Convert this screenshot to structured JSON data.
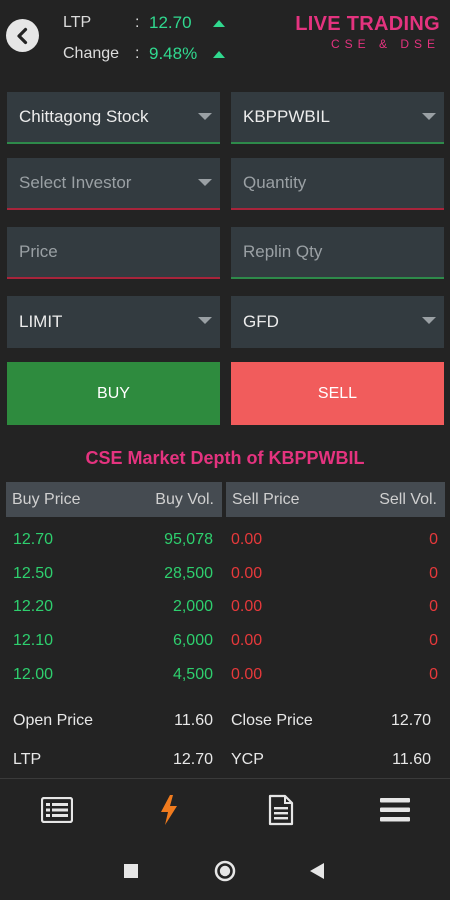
{
  "header": {
    "ltp_label": "LTP",
    "ltp_value": "12.70",
    "change_label": "Change",
    "change_value": "9.48%",
    "colon": ":",
    "brand_title": "LIVE TRADING",
    "brand_subtitle": "CSE & DSE"
  },
  "form": {
    "exchange": "Chittagong Stock",
    "symbol": "KBPPWBIL",
    "investor_placeholder": "Select Investor",
    "quantity_placeholder": "Quantity",
    "price_placeholder": "Price",
    "replin_placeholder": "Replin Qty",
    "order_type": "LIMIT",
    "validity": "GFD",
    "buy_label": "BUY",
    "sell_label": "SELL"
  },
  "depth": {
    "title": "CSE Market Depth of KBPPWBIL",
    "columns": {
      "buy_price": "Buy Price",
      "buy_vol": "Buy Vol.",
      "sell_price": "Sell Price",
      "sell_vol": "Sell Vol."
    },
    "buy_rows": [
      {
        "price": "12.70",
        "vol": "95,078"
      },
      {
        "price": "12.50",
        "vol": "28,500"
      },
      {
        "price": "12.20",
        "vol": "2,000"
      },
      {
        "price": "12.10",
        "vol": "6,000"
      },
      {
        "price": "12.00",
        "vol": "4,500"
      }
    ],
    "sell_rows": [
      {
        "price": "0.00",
        "vol": "0"
      },
      {
        "price": "0.00",
        "vol": "0"
      },
      {
        "price": "0.00",
        "vol": "0"
      },
      {
        "price": "0.00",
        "vol": "0"
      },
      {
        "price": "0.00",
        "vol": "0"
      }
    ]
  },
  "info": {
    "open_label": "Open Price",
    "open_value": "11.60",
    "close_label": "Close Price",
    "close_value": "12.70",
    "ltp_label": "LTP",
    "ltp_value": "12.70",
    "ycp_label": "YCP",
    "ycp_value": "11.60"
  },
  "nav": {
    "icons": [
      "list-icon",
      "lightning-icon",
      "document-icon",
      "menu-icon"
    ],
    "active_color": "#f07b1e"
  },
  "colors": {
    "brand": "#e4337f",
    "up": "#30d98f",
    "buy": "#2e8b3e",
    "sell": "#f15c5c"
  }
}
